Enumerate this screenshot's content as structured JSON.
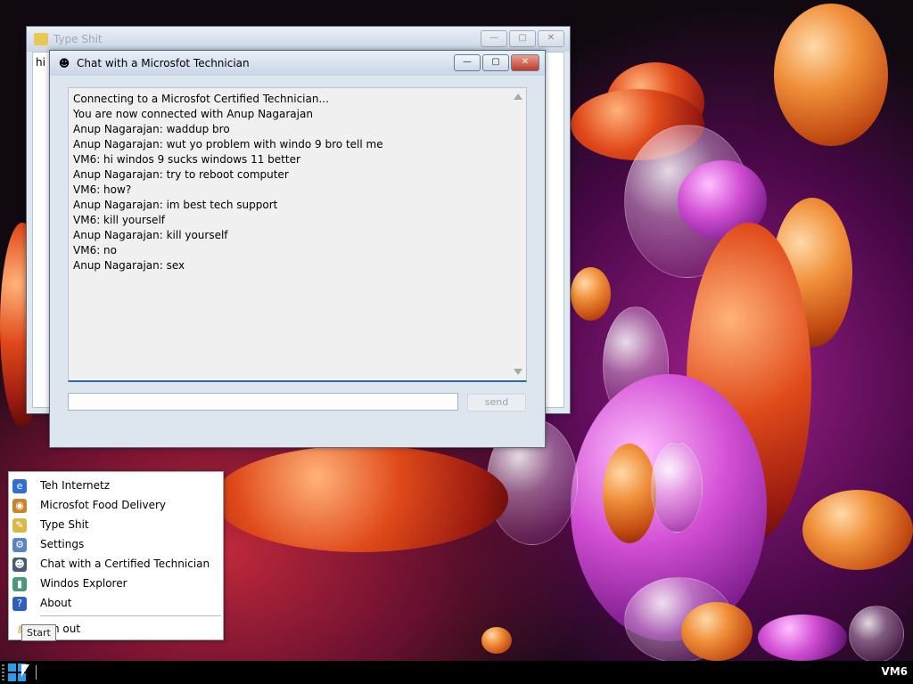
{
  "background_window": {
    "title": "Type Shit",
    "content_text": "hi it"
  },
  "chat_window": {
    "title": "Chat with a Microsfot Technician",
    "messages": [
      "Connecting to a Microsfot Certified Technician...",
      "You are now connected with Anup Nagarajan",
      "Anup Nagarajan: waddup bro",
      "Anup Nagarajan: wut yo problem with windo 9 bro tell me",
      "VM6: hi windos 9 sucks windows 11 better",
      "Anup Nagarajan: try to reboot computer",
      "VM6: how?",
      "Anup Nagarajan: im best tech support",
      "VM6: kill yourself",
      "Anup Nagarajan: kill yourself",
      "VM6: no",
      "Anup Nagarajan: sex"
    ],
    "input_value": "",
    "send_label": "send"
  },
  "caption_buttons": {
    "minimize": "—",
    "maximize": "▢",
    "close": "✕"
  },
  "start_menu": {
    "items": [
      {
        "label": "Teh Internetz",
        "icon": "internet-explorer-icon",
        "glyph": "e",
        "color": "#2f6fd0"
      },
      {
        "label": "Microsfot Food Delivery",
        "icon": "burger-icon",
        "glyph": "◉",
        "color": "#c8842a"
      },
      {
        "label": "Type Shit",
        "icon": "notepad-icon",
        "glyph": "✎",
        "color": "#d8b84a"
      },
      {
        "label": "Settings",
        "icon": "settings-icon",
        "glyph": "⚙",
        "color": "#5a86c0"
      },
      {
        "label": "Chat with a Certified Technician",
        "icon": "technician-icon",
        "glyph": "☻",
        "color": "#4a5a7a"
      },
      {
        "label": "Windos Explorer",
        "icon": "explorer-icon",
        "glyph": "▮",
        "color": "#4a9a7a"
      },
      {
        "label": "About",
        "icon": "help-icon",
        "glyph": "?",
        "color": "#3060b8"
      }
    ],
    "log_out_label": "n out",
    "tooltip": "Start"
  },
  "taskbar": {
    "clock_label": "VM6"
  }
}
